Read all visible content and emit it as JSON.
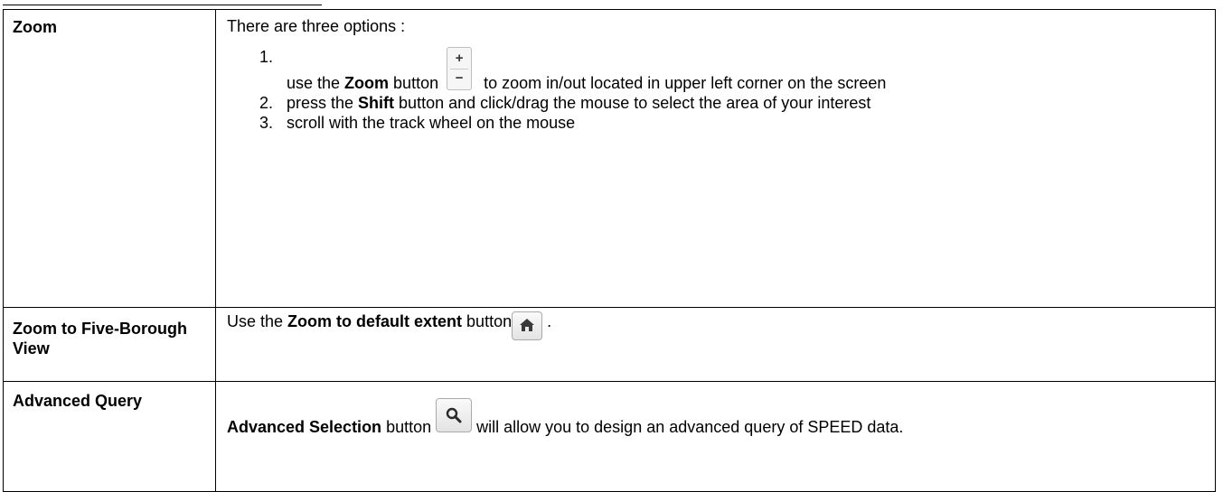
{
  "rows": [
    {
      "term": "Zoom",
      "intro": "There are three options :",
      "options": [
        {
          "num": "1.",
          "before": "use the ",
          "bold": "Zoom",
          "middle": "  button",
          "after": "    to zoom in/out located in upper left corner on the screen",
          "icon": "zoom-plus-minus-icon"
        },
        {
          "num": "2.",
          "before": "press the ",
          "bold": "Shift",
          "after": " button and click/drag the mouse to  select the area of your interest"
        },
        {
          "num": "3.",
          "text": "scroll with the track wheel on the mouse"
        }
      ]
    },
    {
      "term": "Zoom to Five-Borough View",
      "before": "Use the ",
      "bold": "Zoom to default extent",
      "after": " button",
      "end": " .",
      "icon": "home-icon"
    },
    {
      "term": "Advanced Query",
      "bold": "Advanced Selection",
      "after": " button ",
      "end": " will allow you to design an advanced query of SPEED data.",
      "icon": "search-icon"
    }
  ]
}
